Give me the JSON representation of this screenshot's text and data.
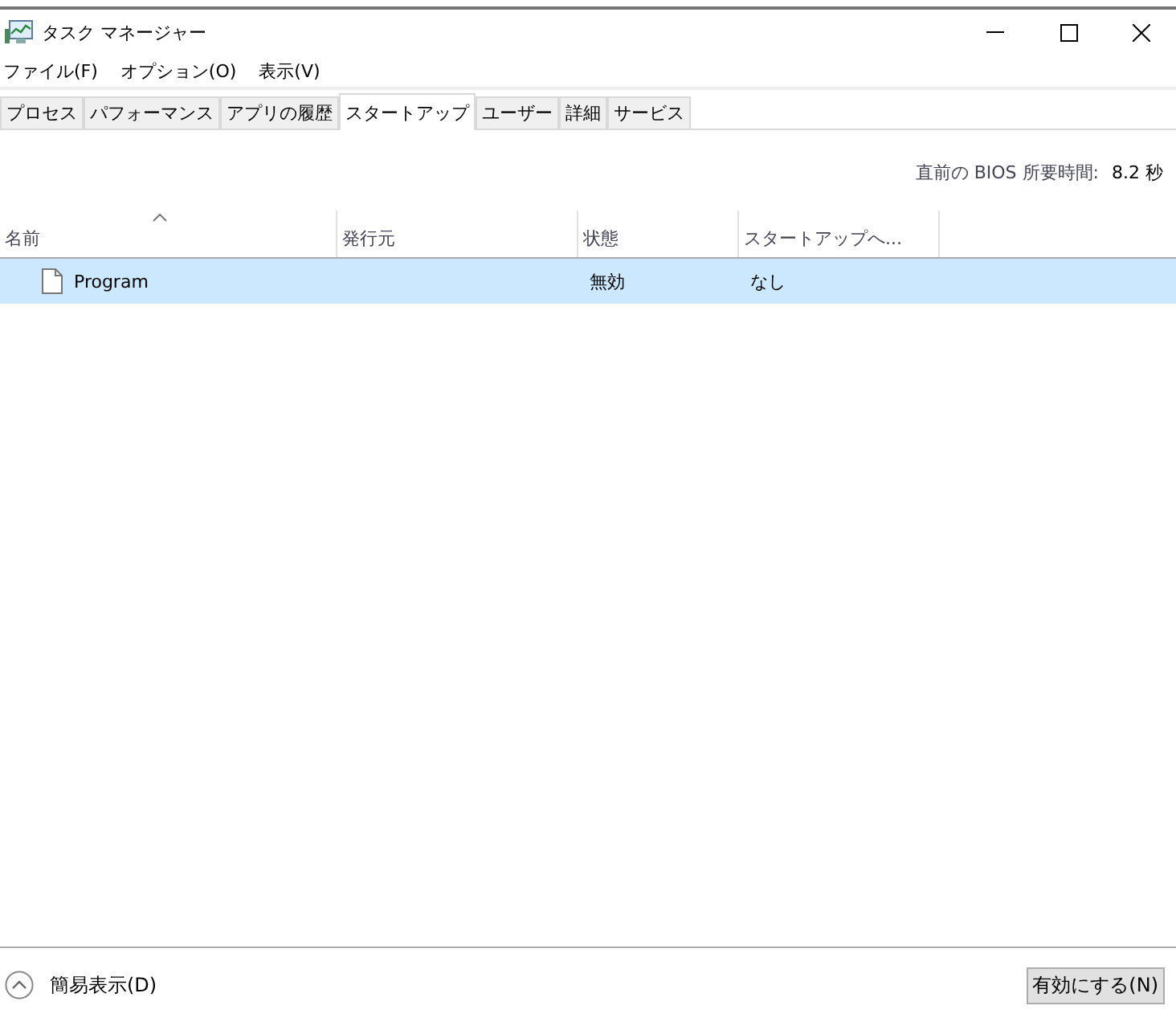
{
  "window": {
    "title": "タスク マネージャー"
  },
  "menu": [
    "ファイル(F)",
    "オプション(O)",
    "表示(V)"
  ],
  "tabs": [
    {
      "label": "プロセス",
      "selected": false
    },
    {
      "label": "パフォーマンス",
      "selected": false
    },
    {
      "label": "アプリの履歴",
      "selected": false
    },
    {
      "label": "スタートアップ",
      "selected": true
    },
    {
      "label": "ユーザー",
      "selected": false
    },
    {
      "label": "詳細",
      "selected": false
    },
    {
      "label": "サービス",
      "selected": false
    }
  ],
  "bios": {
    "label": "直前の BIOS 所要時間:",
    "value": "8.2 秒"
  },
  "table": {
    "columns": [
      {
        "label": "名前",
        "sorted": true
      },
      {
        "label": "発行元",
        "sorted": false
      },
      {
        "label": "状態",
        "sorted": false
      },
      {
        "label": "スタートアップへ...",
        "sorted": false
      }
    ],
    "rows": [
      {
        "cells": [
          "Program",
          "",
          "無効",
          "なし"
        ],
        "selected": true
      }
    ]
  },
  "footer": {
    "toggle": "簡易表示(D)",
    "button": "有効にする(N)"
  }
}
